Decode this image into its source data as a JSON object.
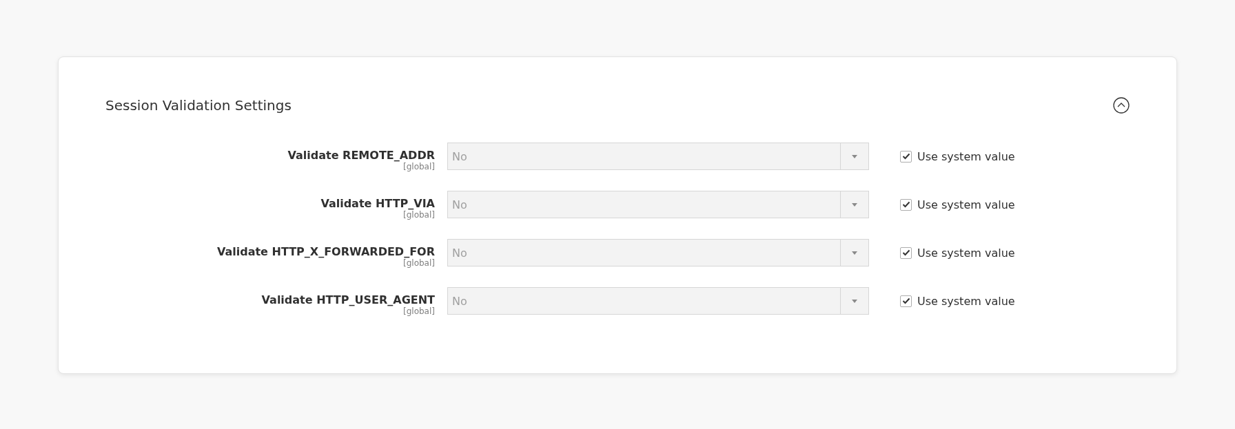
{
  "section": {
    "title": "Session Validation Settings",
    "expanded": true
  },
  "fields": [
    {
      "label": "Validate REMOTE_ADDR",
      "scope": "[global]",
      "value": "No",
      "disabled": true,
      "use_system_value": {
        "label": "Use system value",
        "checked": true
      }
    },
    {
      "label": "Validate HTTP_VIA",
      "scope": "[global]",
      "value": "No",
      "disabled": true,
      "use_system_value": {
        "label": "Use system value",
        "checked": true
      }
    },
    {
      "label": "Validate HTTP_X_FORWARDED_FOR",
      "scope": "[global]",
      "value": "No",
      "disabled": true,
      "use_system_value": {
        "label": "Use system value",
        "checked": true
      }
    },
    {
      "label": "Validate HTTP_USER_AGENT",
      "scope": "[global]",
      "value": "No",
      "disabled": true,
      "use_system_value": {
        "label": "Use system value",
        "checked": true
      }
    }
  ]
}
